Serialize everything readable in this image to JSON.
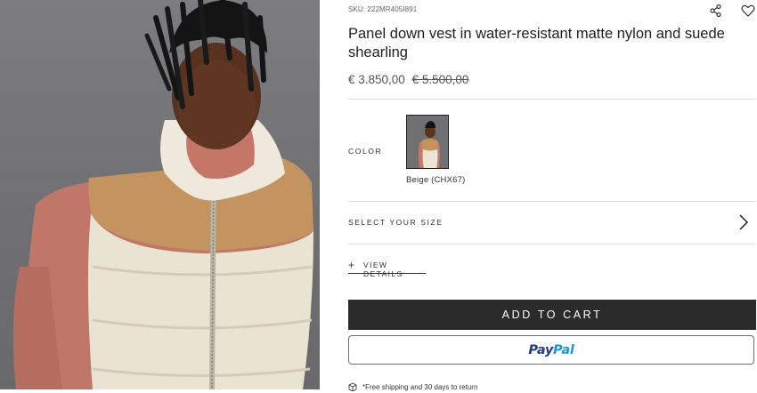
{
  "product": {
    "sku": "SKU: 222MR405I891",
    "title": "Panel down vest in water-resistant matte nylon and suede shearling",
    "price_current": "€ 3.850,00",
    "price_original": "€ 5.500,00"
  },
  "color": {
    "label": "COLOR",
    "selected": "Beige (CHX67)"
  },
  "size": {
    "label": "SELECT YOUR SIZE"
  },
  "details": {
    "label": "VIEW DETAILS"
  },
  "actions": {
    "add_to_cart": "ADD TO CART",
    "paypal_pay": "Pay",
    "paypal_pal": "Pal"
  },
  "shipping": {
    "text": "*Free shipping and 30 days to return"
  },
  "icons": {
    "share": "share-icon",
    "wishlist": "heart-icon",
    "size_arrow": "chevron-right-icon",
    "details_expand": "plus-icon",
    "shipping": "box-icon"
  },
  "colors": {
    "button_dark": "#2b2b2b",
    "paypal_dark_blue": "#253b80",
    "paypal_light_blue": "#179bd7",
    "photo_background": "#757577"
  }
}
